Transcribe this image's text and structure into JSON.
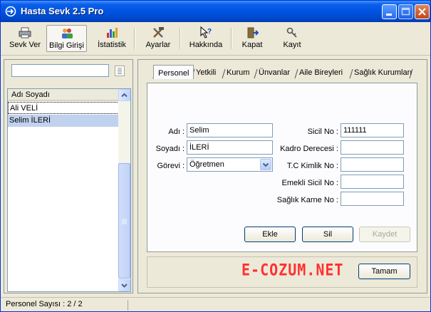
{
  "window": {
    "title": "Hasta Sevk 2.5 Pro"
  },
  "toolbar": {
    "items": [
      {
        "label": "Sevk Ver",
        "icon": "printer-icon"
      },
      {
        "label": "Bilgi Girişi",
        "icon": "users-icon"
      },
      {
        "label": "İstatistik",
        "icon": "chart-icon"
      },
      {
        "label": "Ayarlar",
        "icon": "tools-icon"
      },
      {
        "label": "Hakkında",
        "icon": "help-cursor-icon"
      },
      {
        "label": "Kapat",
        "icon": "exit-door-icon"
      },
      {
        "label": "Kayıt",
        "icon": "keys-icon"
      }
    ]
  },
  "left": {
    "search": {
      "value": ""
    },
    "list": {
      "header": "Adı Soyadı",
      "rows": [
        "Ali VELİ",
        "Selim İLERİ"
      ]
    }
  },
  "tabs": [
    "Personel",
    "Yetkili",
    "Kurum",
    "Ünvanlar",
    "Aile Bireyleri",
    "Sağlık Kurumları"
  ],
  "form": {
    "adi_label": "Adı :",
    "adi_value": "Selim",
    "soyadi_label": "Soyadı :",
    "soyadi_value": "İLERİ",
    "gorevi_label": "Görevi :",
    "gorevi_value": "Öğretmen",
    "sicil_label": "Sicil No :",
    "sicil_value": "111111",
    "kadro_label": "Kadro Derecesi :",
    "kadro_value": "",
    "tc_label": "T.C Kimlik No :",
    "tc_value": "",
    "emekli_label": "Emekli Sicil No :",
    "emekli_value": "",
    "karne_label": "Sağlık Karne No :",
    "karne_value": ""
  },
  "buttons": {
    "ekle": "Ekle",
    "sil": "Sil",
    "kaydet": "Kaydet",
    "tamam": "Tamam"
  },
  "watermark": "E-COZUM.NET",
  "status": {
    "text": "Personel Sayısı : 2 / 2"
  },
  "colors": {
    "titlebar": "#0054e3",
    "selection": "#c1d2ee",
    "watermark": "#ff3030"
  }
}
